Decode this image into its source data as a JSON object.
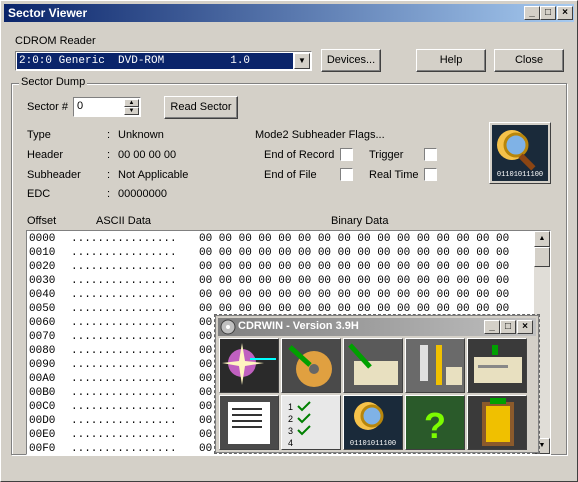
{
  "window": {
    "title": "Sector Viewer"
  },
  "reader": {
    "label": "CDROM Reader",
    "selected": "2:0:0 Generic  DVD-ROM          1.0"
  },
  "buttons": {
    "devices": "Devices...",
    "help": "Help",
    "close": "Close",
    "read_sector": "Read Sector"
  },
  "dump_group": {
    "label": "Sector Dump",
    "sector_label": "Sector #",
    "sector_value": "0"
  },
  "info": [
    {
      "key": "Type",
      "value": "Unknown"
    },
    {
      "key": "Header",
      "value": "00 00 00 00"
    },
    {
      "key": "Subheader",
      "value": "Not Applicable"
    },
    {
      "key": "EDC",
      "value": "00000000"
    }
  ],
  "flags": {
    "title": "Mode2 Subheader Flags...",
    "items": [
      "End of Record",
      "Trigger",
      "End of File",
      "Real Time"
    ]
  },
  "table": {
    "col_offset": "Offset",
    "col_ascii": "ASCII Data",
    "col_binary": "Binary Data",
    "rows": [
      {
        "off": "0000",
        "ascii": "................",
        "bin": "00 00 00 00 00 00 00 00 00 00 00 00 00 00 00 00"
      },
      {
        "off": "0010",
        "ascii": "................",
        "bin": "00 00 00 00 00 00 00 00 00 00 00 00 00 00 00 00"
      },
      {
        "off": "0020",
        "ascii": "................",
        "bin": "00 00 00 00 00 00 00 00 00 00 00 00 00 00 00 00"
      },
      {
        "off": "0030",
        "ascii": "................",
        "bin": "00 00 00 00 00 00 00 00 00 00 00 00 00 00 00 00"
      },
      {
        "off": "0040",
        "ascii": "................",
        "bin": "00 00 00 00 00 00 00 00 00 00 00 00 00 00 00 00"
      },
      {
        "off": "0050",
        "ascii": "................",
        "bin": "00 00 00 00 00 00 00 00 00 00 00 00 00 00 00 00"
      },
      {
        "off": "0060",
        "ascii": "................",
        "bin": "00"
      },
      {
        "off": "0070",
        "ascii": "................",
        "bin": "00"
      },
      {
        "off": "0080",
        "ascii": "................",
        "bin": "00"
      },
      {
        "off": "0090",
        "ascii": "................",
        "bin": "00"
      },
      {
        "off": "00A0",
        "ascii": "................",
        "bin": "00"
      },
      {
        "off": "00B0",
        "ascii": "................",
        "bin": "00"
      },
      {
        "off": "00C0",
        "ascii": "................",
        "bin": "00"
      },
      {
        "off": "00D0",
        "ascii": "................",
        "bin": "00"
      },
      {
        "off": "00E0",
        "ascii": "................",
        "bin": "00"
      },
      {
        "off": "00F0",
        "ascii": "................",
        "bin": "00"
      }
    ]
  },
  "cdrwin": {
    "title": "CDRWIN - Version 3.9H",
    "icon_text": "01101011100",
    "tiles": [
      "record-disc-tile",
      "extract-disc-tile",
      "drive-copy-tile",
      "tools-tile",
      "drive-tile",
      "list-tile",
      "checklist-tile",
      "sector-viewer-tile",
      "help-tile",
      "exit-tile"
    ]
  },
  "large_icon_text": "01101011100"
}
